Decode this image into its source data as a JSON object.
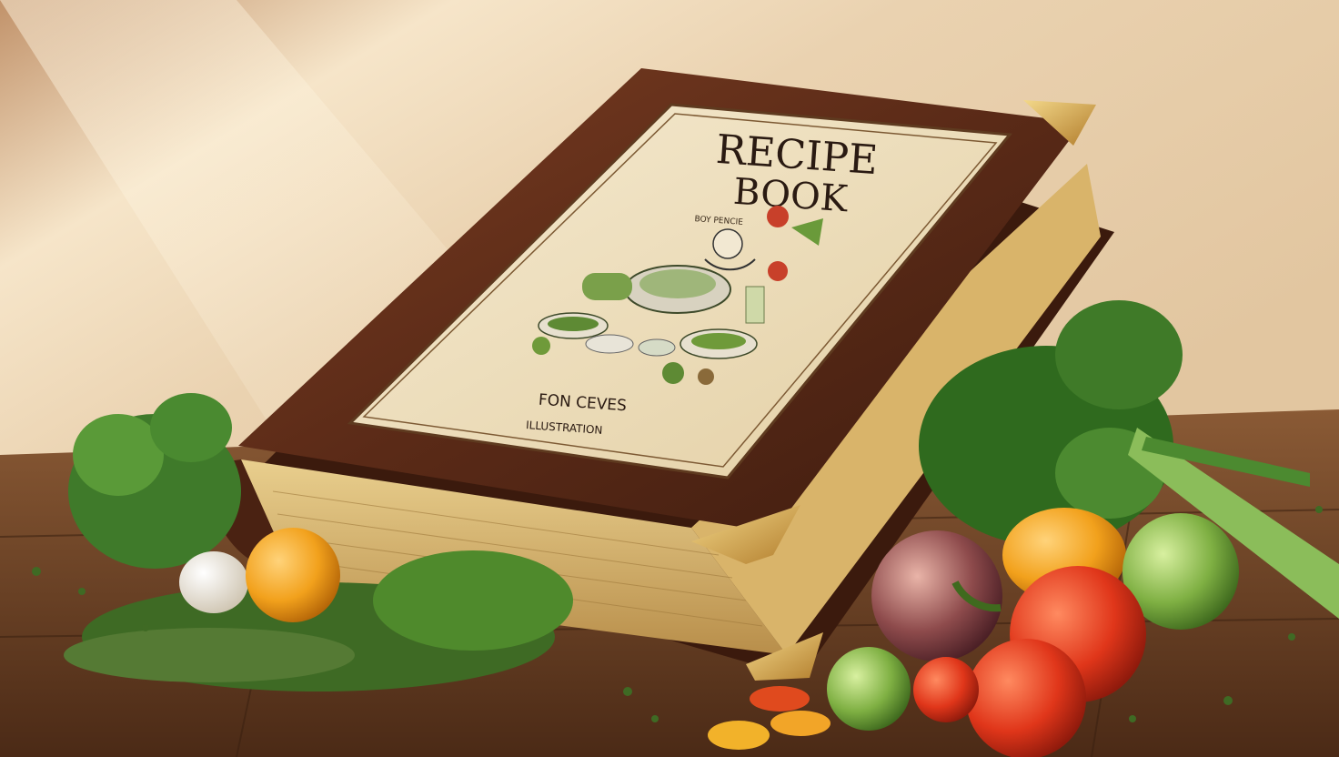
{
  "book": {
    "title_line1": "RECIPE",
    "title_line2": "BOOK",
    "scribble": "BOY PENCIE",
    "subtitle_line1": "FON CEVES",
    "subtitle_line2": "ILLUSTRATION"
  },
  "colors": {
    "wall_light": "#f6e7cf",
    "wall_shadow": "#c99a6a",
    "table": "#6b3f22",
    "leather": "#5a2a17",
    "cover_paper": "#efe1bf",
    "gold": "#d8a845",
    "ink": "#2a1a12"
  }
}
